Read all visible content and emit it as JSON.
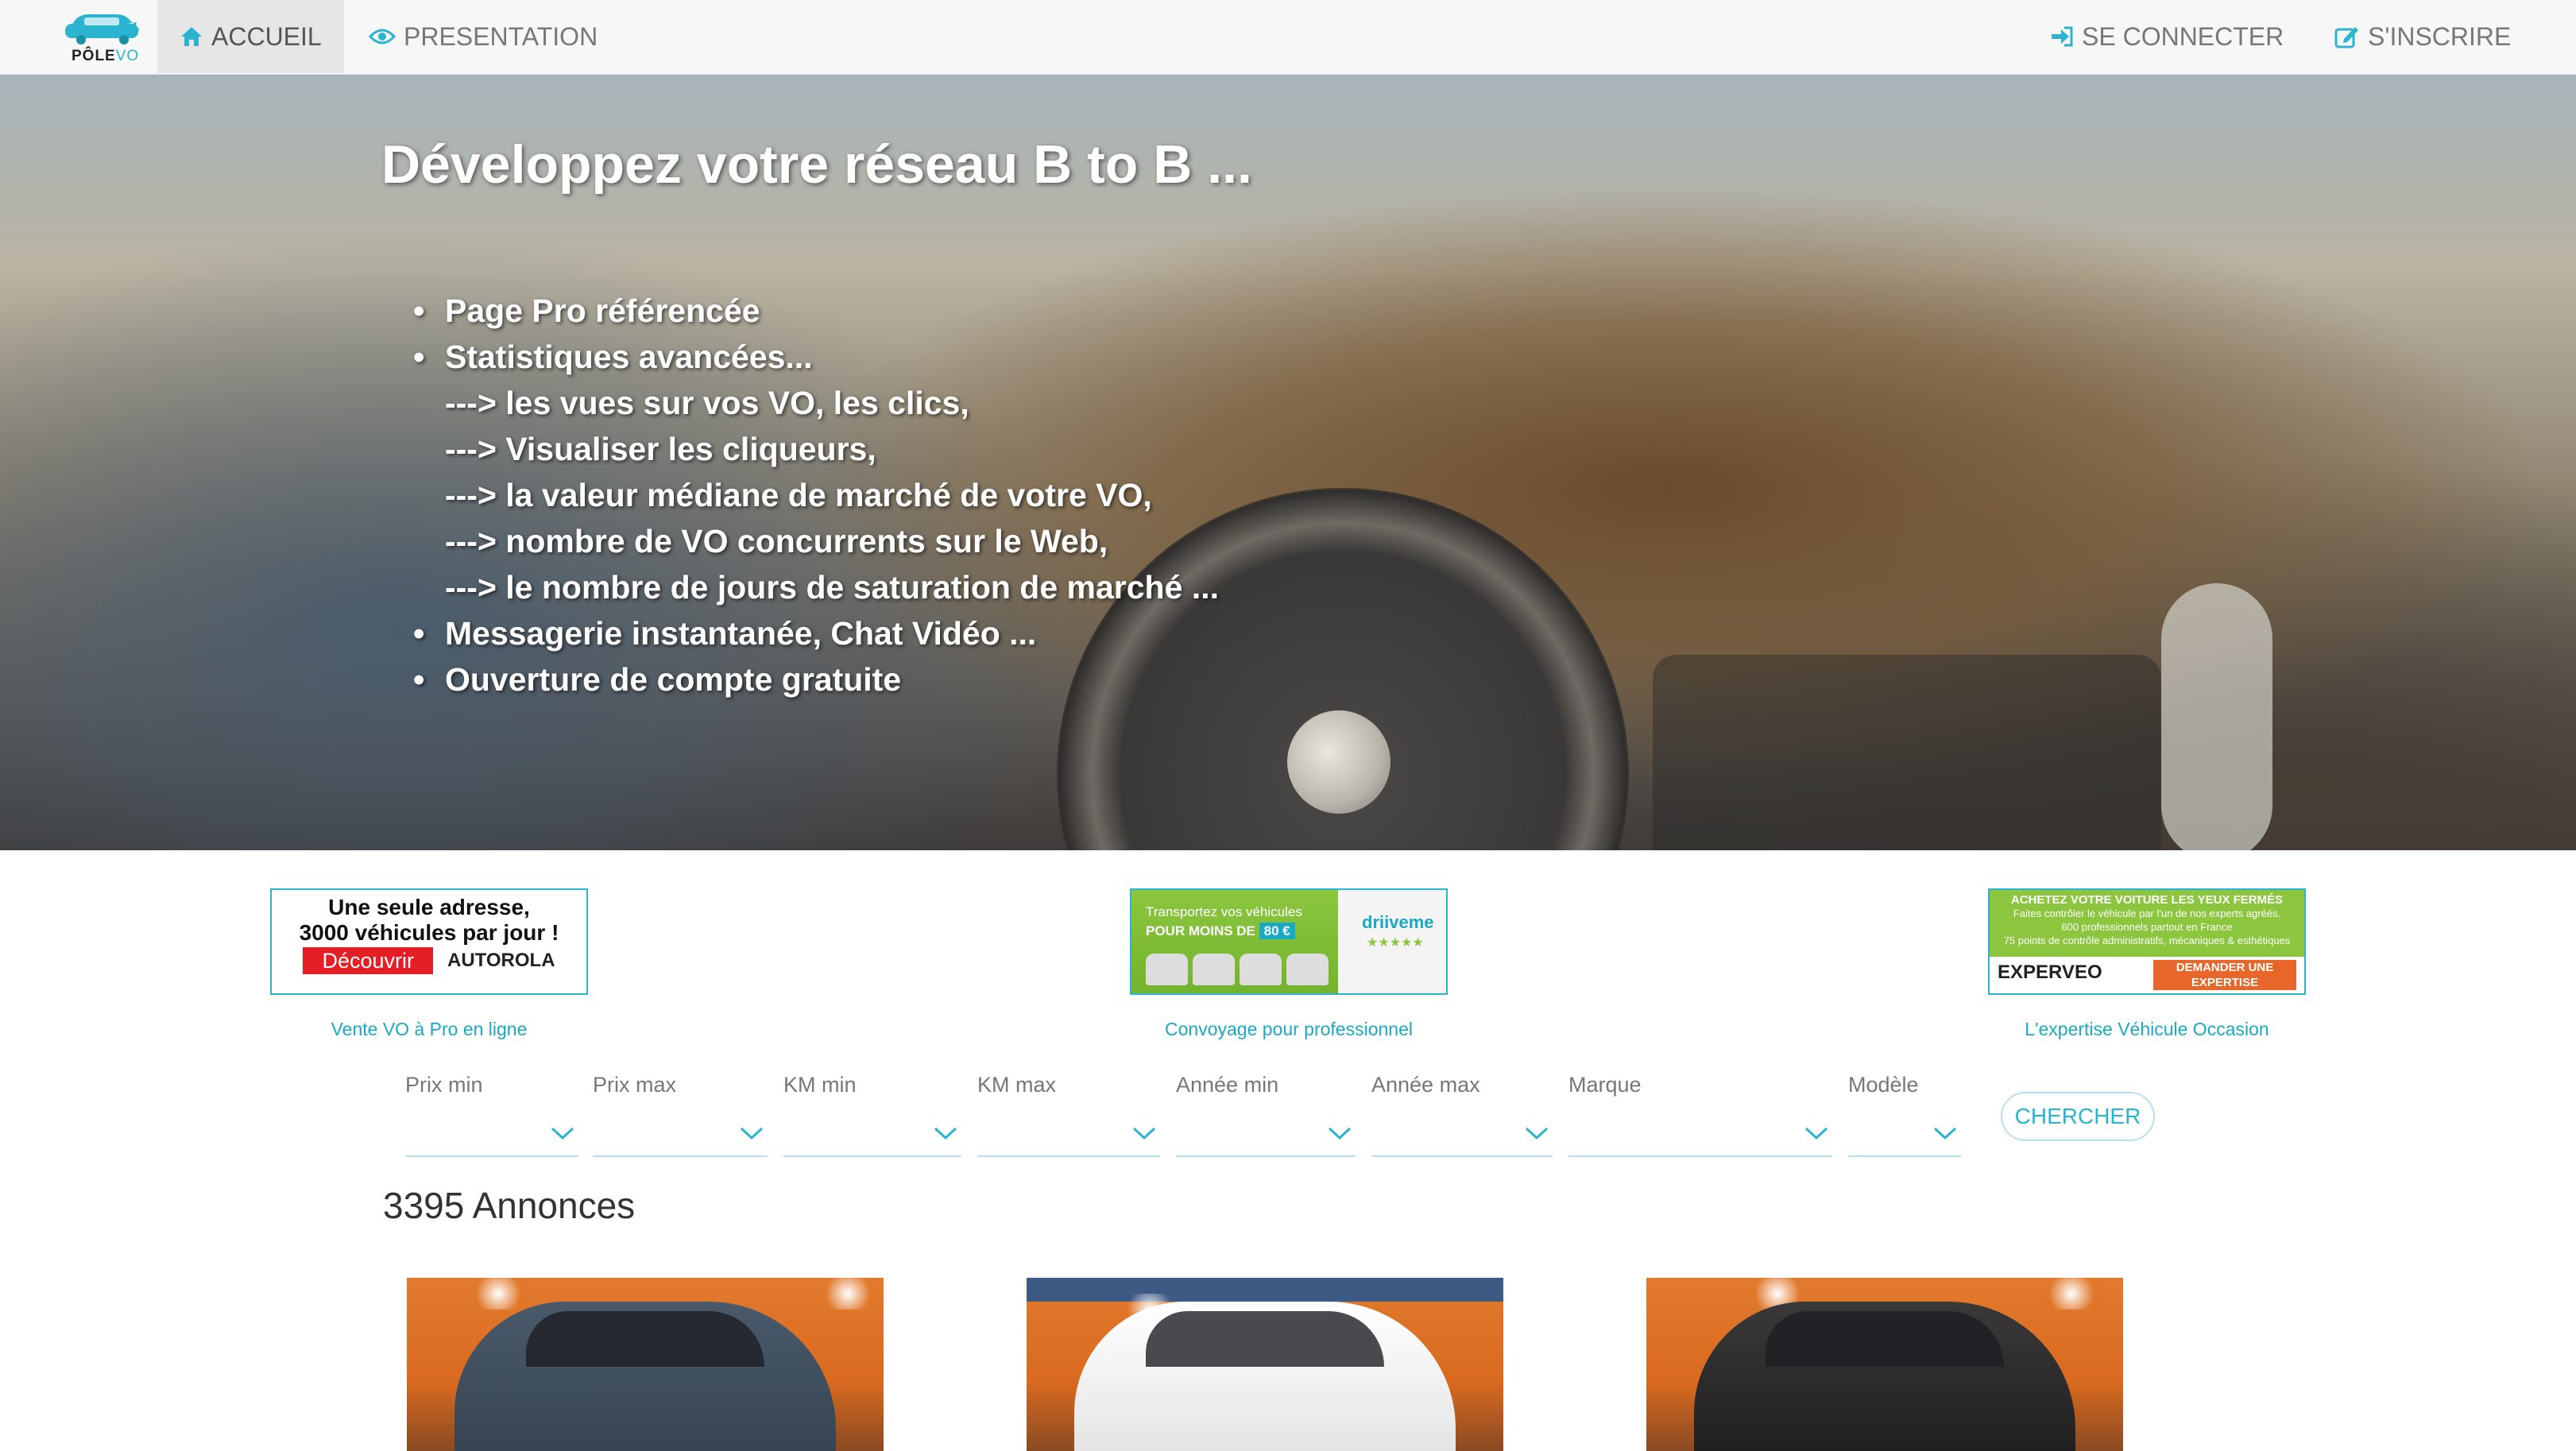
{
  "nav": {
    "logo_text_main": "PÔLE",
    "logo_text_accent": "VO",
    "accueil": "ACCUEIL",
    "presentation": "PRESENTATION",
    "login": "SE CONNECTER",
    "signup": "S'INSCRIRE"
  },
  "hero": {
    "title": "Développez votre réseau B to B ...",
    "items": [
      "Page Pro référencée",
      "Statistiques avancées...",
      "---> les vues sur vos VO, les clics,",
      "---> Visualiser les cliqueurs,",
      "---> la valeur médiane de marché de votre VO,",
      "---> nombre de VO concurrents sur le Web,",
      "---> le nombre de jours de saturation de marché ...",
      "Messagerie instantanée, Chat Vidéo ...",
      "Ouverture de compte gratuite"
    ]
  },
  "banners": [
    {
      "line1": "Une seule adresse,",
      "line2": "3000 véhicules par jour !",
      "cta": "Découvrir",
      "brand": "AUTOROLA",
      "caption": "Vente VO à Pro en ligne"
    },
    {
      "line1": "Transportez vos véhicules",
      "line2": "POUR MOINS DE",
      "price": "80 €",
      "brand": "driiveme",
      "stars": "★★★★★",
      "caption": "Convoyage pour professionnel"
    },
    {
      "headline": "ACHETEZ VOTRE VOITURE LES YEUX FERMÉS",
      "sub1": "Faites contrôler le véhicule par l'un de nos experts agréés.",
      "sub2": "600 professionnels partout en France",
      "sub3": "75 points de contrôle administratifs, mécaniques & esthétiques",
      "brand": "EXPERVEO",
      "cta": "DEMANDER UNE EXPERTISE",
      "caption": "L'expertise Véhicule Occasion"
    }
  ],
  "filters": {
    "prix_min": "Prix min",
    "prix_max": "Prix max",
    "km_min": "KM min",
    "km_max": "KM max",
    "annee_min": "Année min",
    "annee_max": "Année max",
    "marque": "Marque",
    "modele": "Modèle",
    "search": "CHERCHER"
  },
  "listings": {
    "count_label": "3395 Annonces"
  },
  "colors": {
    "accent": "#2ab4cf",
    "nav_bg": "#f7f7f7"
  }
}
